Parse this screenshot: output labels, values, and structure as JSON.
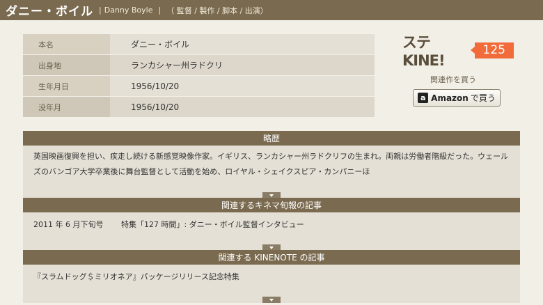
{
  "header": {
    "name": "ダニー・ボイル",
    "separator1": "|",
    "english_name": "Danny Boyle",
    "separator2": "|",
    "roles": "（ 監督 / 製作 / 脚本 / 出演）"
  },
  "profile": [
    {
      "label": "本名",
      "value": "ダニー・ボイル"
    },
    {
      "label": "出身地",
      "value": "ランカシャー州ラドクリ"
    },
    {
      "label": "生年月日",
      "value": "1956/10/20"
    },
    {
      "label": "没年月",
      "value": "1956/10/20"
    }
  ],
  "kinenote": {
    "logo_text": "ステKINE!",
    "count": "125"
  },
  "buy": {
    "label": "関連作を買う",
    "button_brand": "Amazon",
    "button_suffix": "で買う",
    "icon": "amazon-a-icon"
  },
  "sections": {
    "biography": {
      "title": "略歴",
      "text": "英国映画復興を担い、疾走し続ける新感覚映像作家。イギリス、ランカシャー州ラドクリフの生まれ。両親は労働者階級だった。ウェールズのバンゴア大学卒業後に舞台監督として活動を始め、ロイヤル・シェイクスピア・カンパニーほ"
    },
    "kinema": {
      "title": "関連するキネマ旬報の記事",
      "items": [
        {
          "date": "2011 年 6 月下旬号",
          "text": "特集「127 時間」: ダニー・ボイル監督インタビュー"
        }
      ]
    },
    "kinenote_articles": {
      "title": "関連する KINENOTE の記事",
      "items": [
        {
          "text": "『スラムドッグ＄ミリオネア』パッケージリリース記念特集"
        }
      ]
    }
  },
  "colors": {
    "header_bg": "#7a6a4f",
    "page_bg": "#f2efe7",
    "accent": "#f26b3a"
  }
}
